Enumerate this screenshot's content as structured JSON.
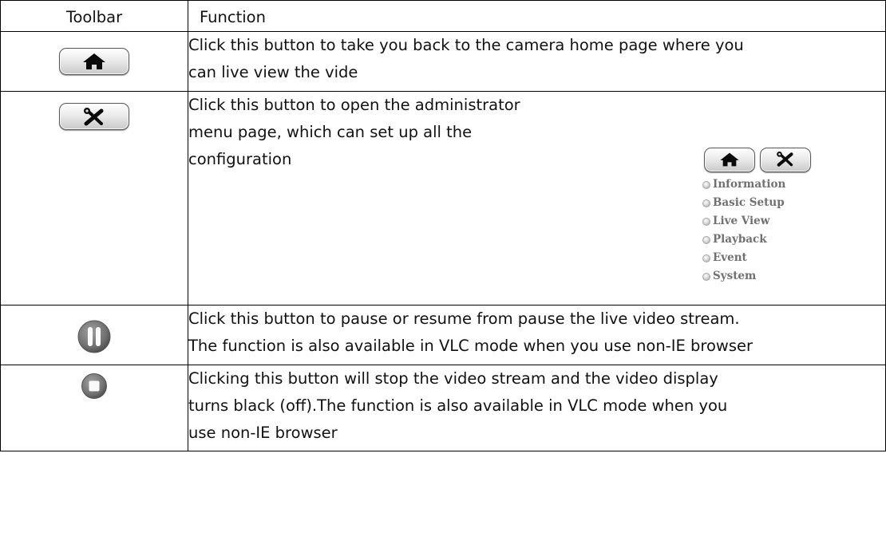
{
  "table": {
    "header": {
      "toolbar": "Toolbar",
      "function": "Function"
    },
    "rows": [
      {
        "icon": "home-icon",
        "lines": [
          "Click this button to take you back to the camera home page where you",
          "can live view the vide"
        ]
      },
      {
        "icon": "tools-icon",
        "lines": [
          "Click this button to open the administrator",
          "menu page, which can set up all the",
          "configuration"
        ],
        "menu_preview": {
          "buttons": [
            "home-icon",
            "tools-icon"
          ],
          "items": [
            "Information",
            "Basic Setup",
            "Live View",
            "Playback",
            "Event",
            "System"
          ]
        }
      },
      {
        "icon": "pause-icon",
        "lines": [
          "Click this button to pause or resume from pause the live video stream.",
          "The function is also available in VLC mode when you use non-IE browser"
        ]
      },
      {
        "icon": "stop-icon",
        "lines": [
          "Clicking this button will stop the video stream and the video display",
          "turns black (off).The function is also available in VLC mode when you",
          "use non-IE browser"
        ]
      }
    ]
  },
  "colors": {
    "border": "#000000",
    "menu_text": "#707070",
    "button_face": "#e9e9e9"
  }
}
